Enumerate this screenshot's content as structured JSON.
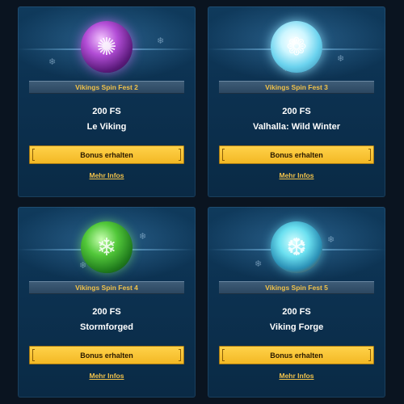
{
  "cards": [
    {
      "title": "Vikings Spin Fest 2",
      "free_spins": "200 FS",
      "game": "Le Viking",
      "button_label": "Bonus erhalten",
      "link_label": "Mehr Infos",
      "orb_icon": "purple-crystal-orb-icon",
      "orb_color": "#b24dd6"
    },
    {
      "title": "Vikings Spin Fest 3",
      "free_spins": "200 FS",
      "game": "Valhalla: Wild Winter",
      "button_label": "Bonus erhalten",
      "link_label": "Mehr Infos",
      "orb_icon": "white-snowflake-orb-icon",
      "orb_color": "#cdf6ff"
    },
    {
      "title": "Vikings Spin Fest 4",
      "free_spins": "200 FS",
      "game": "Stormforged",
      "button_label": "Bonus erhalten",
      "link_label": "Mehr Infos",
      "orb_icon": "green-holly-orb-icon",
      "orb_color": "#52c83a"
    },
    {
      "title": "Vikings Spin Fest 5",
      "free_spins": "200 FS",
      "game": "Viking Forge",
      "button_label": "Bonus erhalten",
      "link_label": "Mehr Infos",
      "orb_icon": "teal-snow-globe-icon",
      "orb_color": "#6be0f0"
    }
  ],
  "colors": {
    "accent_gold": "#f1c24a",
    "button_bg": "#ffd24a",
    "card_bg": "#0c3150"
  }
}
